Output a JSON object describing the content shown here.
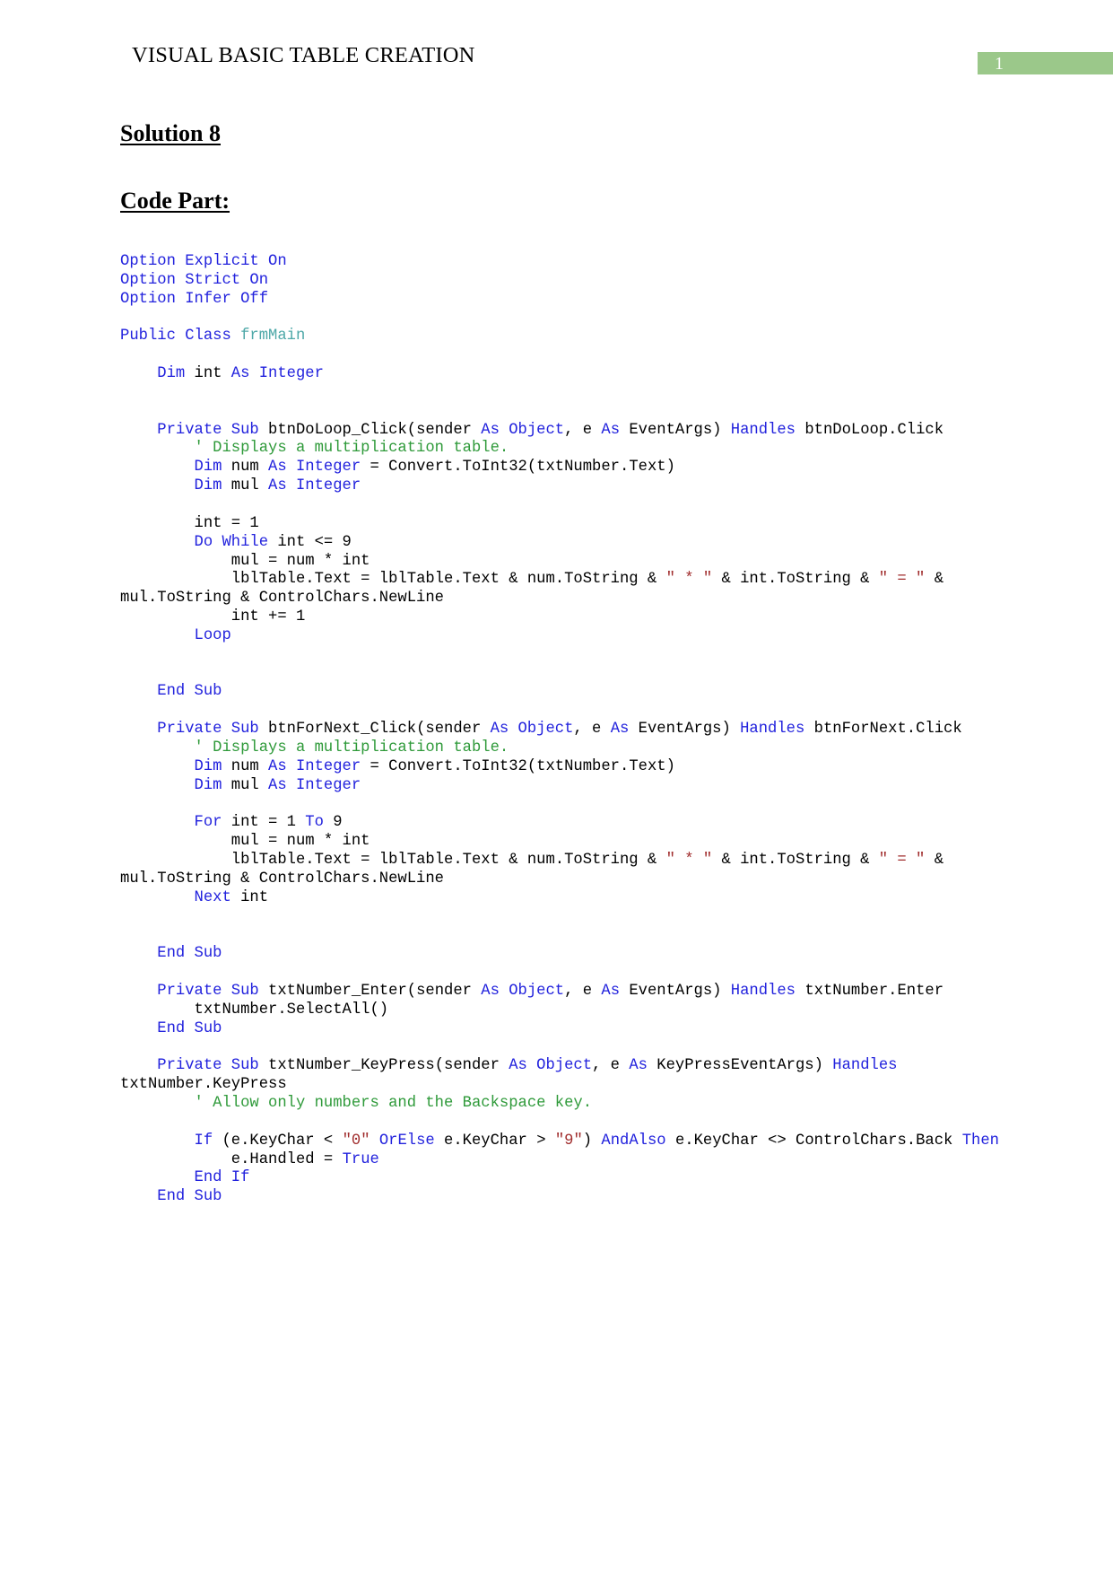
{
  "header": {
    "title": "VISUAL BASIC TABLE CREATION",
    "page_number": "1",
    "badge_color": "#9bc88a"
  },
  "headings": {
    "solution": "Solution 8",
    "code_part": "Code Part:"
  },
  "colors": {
    "keyword": "#2222dd",
    "class_name": "#4ea8a8",
    "comment": "#2f9a3a",
    "string": "#a02c2c",
    "plain": "#000000"
  },
  "code": {
    "language": "Visual Basic .NET",
    "lines": [
      [
        {
          "t": "Option Explicit On",
          "c": "k"
        }
      ],
      [
        {
          "t": "Option Strict On",
          "c": "k"
        }
      ],
      [
        {
          "t": "Option Infer Off",
          "c": "k"
        }
      ],
      [],
      [
        {
          "t": "Public Class ",
          "c": "k"
        },
        {
          "t": "frmMain",
          "c": "cls"
        }
      ],
      [],
      [
        {
          "t": "    ",
          "c": "pl"
        },
        {
          "t": "Dim ",
          "c": "k"
        },
        {
          "t": "int ",
          "c": "pl"
        },
        {
          "t": "As Integer",
          "c": "k"
        }
      ],
      [],
      [],
      [
        {
          "t": "    ",
          "c": "pl"
        },
        {
          "t": "Private Sub ",
          "c": "k"
        },
        {
          "t": "btnDoLoop_Click(sender ",
          "c": "pl"
        },
        {
          "t": "As Object",
          "c": "k"
        },
        {
          "t": ", e ",
          "c": "pl"
        },
        {
          "t": "As ",
          "c": "k"
        },
        {
          "t": "EventArgs) ",
          "c": "pl"
        },
        {
          "t": "Handles",
          "c": "k"
        },
        {
          "t": " btnDoLoop.Click",
          "c": "pl"
        }
      ],
      [
        {
          "t": "        ",
          "c": "pl"
        },
        {
          "t": "' Displays a multiplication table.",
          "c": "cm"
        }
      ],
      [
        {
          "t": "        ",
          "c": "pl"
        },
        {
          "t": "Dim ",
          "c": "k"
        },
        {
          "t": "num ",
          "c": "pl"
        },
        {
          "t": "As Integer",
          "c": "k"
        },
        {
          "t": " = Convert.ToInt32(txtNumber.Text)",
          "c": "pl"
        }
      ],
      [
        {
          "t": "        ",
          "c": "pl"
        },
        {
          "t": "Dim ",
          "c": "k"
        },
        {
          "t": "mul ",
          "c": "pl"
        },
        {
          "t": "As Integer",
          "c": "k"
        }
      ],
      [],
      [
        {
          "t": "        int = 1",
          "c": "pl"
        }
      ],
      [
        {
          "t": "        ",
          "c": "pl"
        },
        {
          "t": "Do While ",
          "c": "k"
        },
        {
          "t": "int <= 9",
          "c": "pl"
        }
      ],
      [
        {
          "t": "            mul = num * int",
          "c": "pl"
        }
      ],
      [
        {
          "t": "            lblTable.Text = lblTable.Text & num.ToString & ",
          "c": "pl"
        },
        {
          "t": "\" * \"",
          "c": "st"
        },
        {
          "t": " & int.ToString & ",
          "c": "pl"
        },
        {
          "t": "\" = \"",
          "c": "st"
        },
        {
          "t": " & mul.ToString & ControlChars.NewLine",
          "c": "pl"
        }
      ],
      [
        {
          "t": "            int += 1",
          "c": "pl"
        }
      ],
      [
        {
          "t": "        ",
          "c": "pl"
        },
        {
          "t": "Loop",
          "c": "k"
        }
      ],
      [],
      [],
      [
        {
          "t": "    ",
          "c": "pl"
        },
        {
          "t": "End Sub",
          "c": "k"
        }
      ],
      [],
      [
        {
          "t": "    ",
          "c": "pl"
        },
        {
          "t": "Private Sub ",
          "c": "k"
        },
        {
          "t": "btnForNext_Click(sender ",
          "c": "pl"
        },
        {
          "t": "As Object",
          "c": "k"
        },
        {
          "t": ", e ",
          "c": "pl"
        },
        {
          "t": "As ",
          "c": "k"
        },
        {
          "t": "EventArgs) ",
          "c": "pl"
        },
        {
          "t": "Handles",
          "c": "k"
        },
        {
          "t": " btnForNext.Click",
          "c": "pl"
        }
      ],
      [
        {
          "t": "        ",
          "c": "pl"
        },
        {
          "t": "' Displays a multiplication table.",
          "c": "cm"
        }
      ],
      [
        {
          "t": "        ",
          "c": "pl"
        },
        {
          "t": "Dim ",
          "c": "k"
        },
        {
          "t": "num ",
          "c": "pl"
        },
        {
          "t": "As Integer",
          "c": "k"
        },
        {
          "t": " = Convert.ToInt32(txtNumber.Text)",
          "c": "pl"
        }
      ],
      [
        {
          "t": "        ",
          "c": "pl"
        },
        {
          "t": "Dim ",
          "c": "k"
        },
        {
          "t": "mul ",
          "c": "pl"
        },
        {
          "t": "As Integer",
          "c": "k"
        }
      ],
      [],
      [
        {
          "t": "        ",
          "c": "pl"
        },
        {
          "t": "For ",
          "c": "k"
        },
        {
          "t": "int = 1 ",
          "c": "pl"
        },
        {
          "t": "To ",
          "c": "k"
        },
        {
          "t": "9",
          "c": "pl"
        }
      ],
      [
        {
          "t": "            mul = num * int",
          "c": "pl"
        }
      ],
      [
        {
          "t": "            lblTable.Text = lblTable.Text & num.ToString & ",
          "c": "pl"
        },
        {
          "t": "\" * \"",
          "c": "st"
        },
        {
          "t": " & int.ToString & ",
          "c": "pl"
        },
        {
          "t": "\" = \"",
          "c": "st"
        },
        {
          "t": " & mul.ToString & ControlChars.NewLine",
          "c": "pl"
        }
      ],
      [
        {
          "t": "        ",
          "c": "pl"
        },
        {
          "t": "Next ",
          "c": "k"
        },
        {
          "t": "int",
          "c": "pl"
        }
      ],
      [],
      [],
      [
        {
          "t": "    ",
          "c": "pl"
        },
        {
          "t": "End Sub",
          "c": "k"
        }
      ],
      [],
      [
        {
          "t": "    ",
          "c": "pl"
        },
        {
          "t": "Private Sub ",
          "c": "k"
        },
        {
          "t": "txtNumber_Enter(sender ",
          "c": "pl"
        },
        {
          "t": "As Object",
          "c": "k"
        },
        {
          "t": ", e ",
          "c": "pl"
        },
        {
          "t": "As ",
          "c": "k"
        },
        {
          "t": "EventArgs) ",
          "c": "pl"
        },
        {
          "t": "Handles",
          "c": "k"
        },
        {
          "t": " txtNumber.Enter",
          "c": "pl"
        }
      ],
      [
        {
          "t": "        txtNumber.SelectAll()",
          "c": "pl"
        }
      ],
      [
        {
          "t": "    ",
          "c": "pl"
        },
        {
          "t": "End Sub",
          "c": "k"
        }
      ],
      [],
      [
        {
          "t": "    ",
          "c": "pl"
        },
        {
          "t": "Private Sub ",
          "c": "k"
        },
        {
          "t": "txtNumber_KeyPress(sender ",
          "c": "pl"
        },
        {
          "t": "As Object",
          "c": "k"
        },
        {
          "t": ", e ",
          "c": "pl"
        },
        {
          "t": "As ",
          "c": "k"
        },
        {
          "t": "KeyPressEventArgs) ",
          "c": "pl"
        },
        {
          "t": "Handles",
          "c": "k"
        },
        {
          "t": " txtNumber.KeyPress",
          "c": "pl"
        }
      ],
      [
        {
          "t": "        ",
          "c": "pl"
        },
        {
          "t": "' Allow only numbers and the Backspace key.",
          "c": "cm"
        }
      ],
      [],
      [
        {
          "t": "        ",
          "c": "pl"
        },
        {
          "t": "If ",
          "c": "k"
        },
        {
          "t": "(e.KeyChar < ",
          "c": "pl"
        },
        {
          "t": "\"0\"",
          "c": "st"
        },
        {
          "t": " ",
          "c": "pl"
        },
        {
          "t": "OrElse",
          "c": "k"
        },
        {
          "t": " e.KeyChar > ",
          "c": "pl"
        },
        {
          "t": "\"9\"",
          "c": "st"
        },
        {
          "t": ") ",
          "c": "pl"
        },
        {
          "t": "AndAlso",
          "c": "k"
        },
        {
          "t": " e.KeyChar <> ControlChars.Back ",
          "c": "pl"
        },
        {
          "t": "Then",
          "c": "k"
        }
      ],
      [
        {
          "t": "            e.Handled = ",
          "c": "pl"
        },
        {
          "t": "True",
          "c": "k"
        }
      ],
      [
        {
          "t": "        ",
          "c": "pl"
        },
        {
          "t": "End If",
          "c": "k"
        }
      ],
      [
        {
          "t": "    ",
          "c": "pl"
        },
        {
          "t": "End Sub",
          "c": "k"
        }
      ]
    ]
  }
}
